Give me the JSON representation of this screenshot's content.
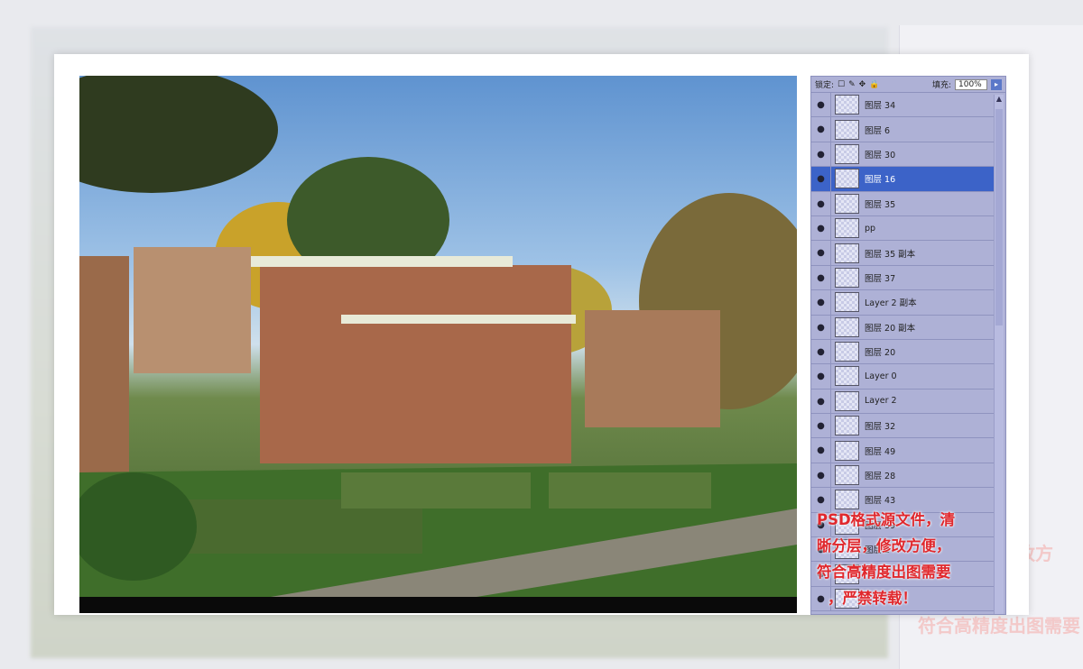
{
  "panel": {
    "lock_label": "锁定:",
    "fill_label": "填充:",
    "fill_value": "100%",
    "layers": [
      {
        "name": "图层 34"
      },
      {
        "name": "图层 6"
      },
      {
        "name": "图层 30"
      },
      {
        "name": "图层 16",
        "selected": true
      },
      {
        "name": "图层 35"
      },
      {
        "name": "pp"
      },
      {
        "name": "图层 35 副本"
      },
      {
        "name": "图层 37"
      },
      {
        "name": "Layer 2 副本"
      },
      {
        "name": "图层 20 副本"
      },
      {
        "name": "图层 20"
      },
      {
        "name": "Layer 0"
      },
      {
        "name": "Layer 2"
      },
      {
        "name": "图层 32"
      },
      {
        "name": "图层 49"
      },
      {
        "name": "图层 28"
      },
      {
        "name": "图层 43"
      },
      {
        "name": "图层 39"
      },
      {
        "name": "图层 2"
      },
      {
        "name": ""
      },
      {
        "name": ""
      }
    ]
  },
  "notice": {
    "line1": "PSD格式源文件，清",
    "line2": "晰分层，修改方便，",
    "line3": "符合高精度出图需要",
    "line4": "，严禁转载！"
  },
  "colors": {
    "selected": "#3c63c8",
    "notice": "#e0282d",
    "panel": "#aeb1d6"
  }
}
